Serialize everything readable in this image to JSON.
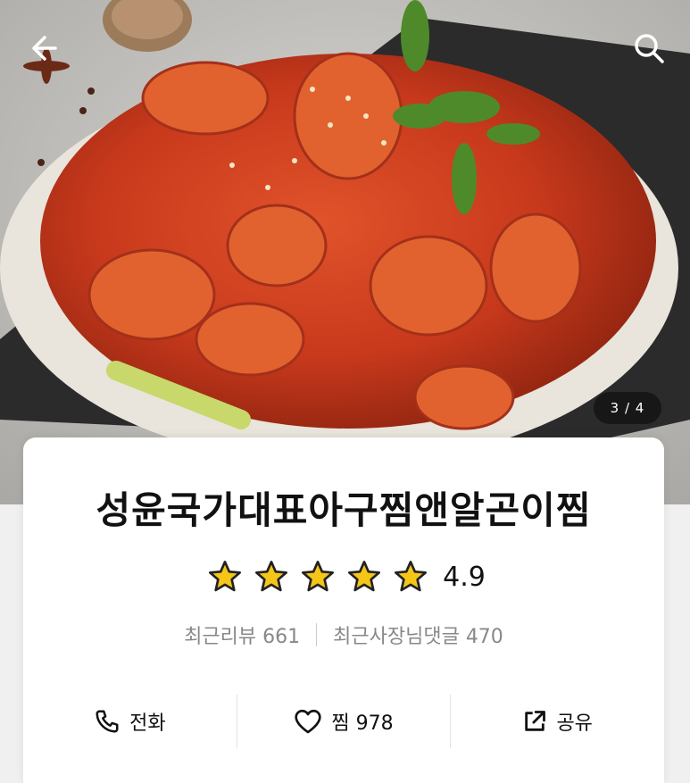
{
  "hero": {
    "page_indicator": "3 / 4"
  },
  "store": {
    "name": "성윤국가대표아구찜앤알곤이찜",
    "rating_value": "4.9",
    "rating_stars": 5,
    "recent_reviews_label": "최근리뷰 661",
    "recent_owner_replies_label": "최근사장님댓글 470"
  },
  "actions": {
    "call_label": "전화",
    "favorite_label": "찜 978",
    "share_label": "공유"
  },
  "colors": {
    "star": "#F5C518",
    "star_outline": "#222222",
    "card_bg": "#FFFFFF",
    "indicator_bg": "#4A4A4A"
  },
  "icons": [
    "back-arrow-icon",
    "search-icon",
    "phone-icon",
    "heart-icon",
    "share-icon",
    "star-icon"
  ]
}
